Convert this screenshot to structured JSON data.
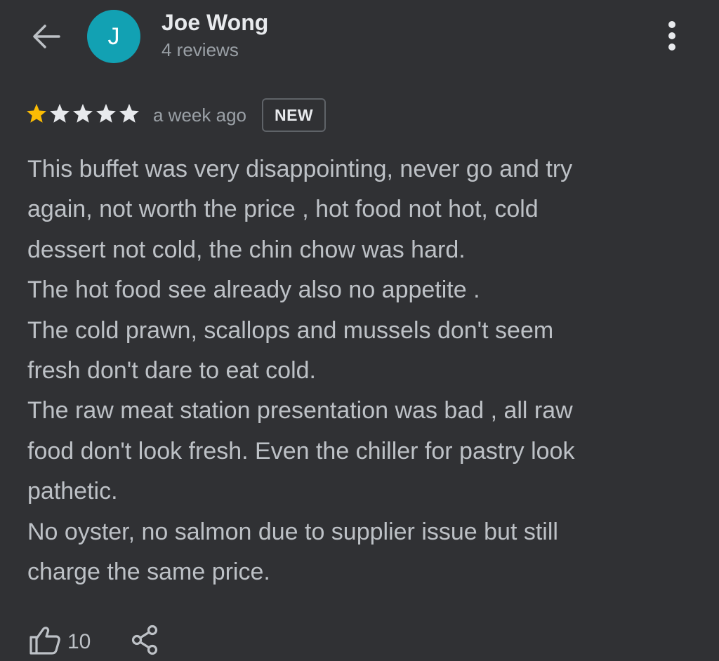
{
  "header": {
    "back_icon": "arrow-left-icon",
    "avatar_letter": "J",
    "avatar_color": "#12a1b3",
    "reviewer_name": "Joe Wong",
    "review_count": "4 reviews",
    "more_icon": "more-vertical-icon"
  },
  "review": {
    "rating": 1,
    "max_rating": 5,
    "star_filled_color": "#fbbc04",
    "star_empty_color": "#e8eaed",
    "time_ago": "a week ago",
    "badge": "NEW",
    "lines": [
      "This buffet was very disappointing, never go and try",
      "again, not worth the price , hot food not hot, cold",
      "dessert not cold, the chin chow was hard.",
      "The hot food see already also no appetite .",
      "The cold prawn, scallops and mussels don't seem",
      "fresh don't dare to eat cold.",
      "The raw meat station presentation was bad , all raw",
      "food don't look fresh. Even the chiller for pastry look",
      "pathetic.",
      "No oyster, no salmon due to supplier issue but still",
      "charge the same price."
    ]
  },
  "actions": {
    "like_icon": "thumbs-up-icon",
    "like_count": "10",
    "share_icon": "share-icon"
  }
}
